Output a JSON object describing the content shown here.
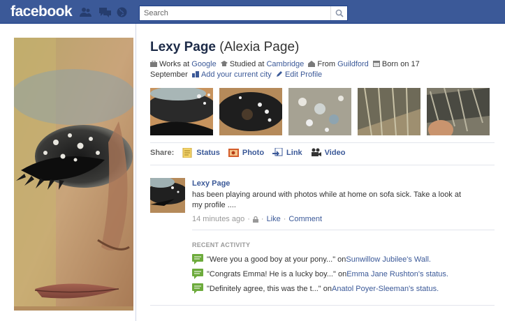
{
  "topbar": {
    "logo": "facebook",
    "search_placeholder": "Search"
  },
  "profile": {
    "name": "Lexy Page",
    "alternate_name": "(Alexia Page)",
    "works_prefix": "Works at",
    "works_link": "Google",
    "studied_prefix": "Studied at",
    "studied_link": "Cambridge",
    "from_prefix": "From",
    "from_link": "Guildford",
    "born_text": "Born on 17",
    "born_text_2": "September",
    "add_city": "Add your current city",
    "edit_profile": "Edit Profile"
  },
  "share": {
    "label": "Share:",
    "items": [
      "Status",
      "Photo",
      "Link",
      "Video"
    ]
  },
  "story": {
    "author": "Lexy Page",
    "text": "has been playing around with photos while at home on sofa sick. Take a look at my profile ....",
    "time": "14 minutes ago",
    "like": "Like",
    "comment": "Comment"
  },
  "recent_activity": {
    "title": "RECENT ACTIVITY",
    "items": [
      {
        "quote": "\"Were you a good boy at your pony...\" on ",
        "link": "Sunwillow Jubilee",
        "suffix": "'s Wall."
      },
      {
        "quote": "\"Congrats Emma! He is a lucky boy...\" on ",
        "link": "Emma Jane Rushton",
        "suffix": "'s status."
      },
      {
        "quote": "\"Definitely agree, this was the t...\" on ",
        "link": "Anatol Poyer-Sleeman",
        "suffix": "'s status."
      }
    ]
  },
  "colors": {
    "brand_blue": "#3b5998",
    "link_blue": "#3b5998",
    "topbar_border": "#133783"
  }
}
